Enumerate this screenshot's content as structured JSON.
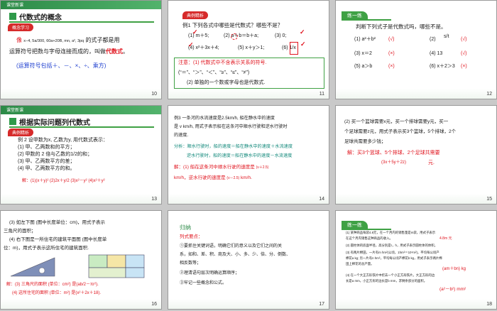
{
  "slides": [
    {
      "num": "10",
      "header": "课堂新课",
      "title": "代数式的概念",
      "tag": "概念学习",
      "line1_a": "像",
      "line1_formula": "x−4, 5a/300, 60a+20B, mn, a², 3pq",
      "line1_b": "的式子都是用",
      "line2_a": "运算符号把数与字母连接而成的，叫做",
      "line2_b": "代数式",
      "line2_c": "。",
      "line3": "(运算符号包括＋、－、×、÷、乘方)"
    },
    {
      "num": "11",
      "tag": "典例精析",
      "q": "例1  下列各式中哪些是代数式？哪些不是？",
      "opt1": "(1) m＋5;",
      "opt2": "(2) a＋b＝b＋a;",
      "opt3": "(3) 0;",
      "opt4": "(4) x²＋3x＋4;",
      "opt5": "(5) x＋y＞1;",
      "opt6": "(6) 1/x",
      "note1": "注意：(1) 代数式中不含表示关系的符号.",
      "note2": "(“＝”、“＞”、“＜”、“≥”、“≤”、“≠”)",
      "note3": "(2) 单独的一个数或字母也是代数式."
    },
    {
      "num": "12",
      "tag": "练一练",
      "q": "判断下列式子是代数式吗，哪些不是。",
      "r1a": "(1) a²＋b²",
      "r1b": "(√)",
      "r1c": "(2)",
      "r1d": "s/t",
      "r1e": "(√)",
      "r2a": "(3) x＝2",
      "r2b": "(×)",
      "r2c": "(4) 13",
      "r2d": "(√)",
      "r3a": "(5) a＞b",
      "r3b": "(×)",
      "r3c": "(6) x＋2＞3",
      "r3d": "(×)"
    },
    {
      "num": "13",
      "header": "课堂新课",
      "title": "根据实际问题列代数式",
      "tag": "典例精析",
      "l1": "例 2 设甲数为x, 乙数为y, 用代数式表示：",
      "l2": "(1) 甲、乙两数和的平方；",
      "l3": "(2) 甲数的 2 倍与乙数的1/2的和；",
      "l4": "(3) 甲、乙两数平方的差；",
      "l5": "(4) 甲、乙两数平方的和。",
      "ans": "解：(1)(x＋y)²  (2)2x＋y/2  (3)x²－y²  (4)x²＋y²"
    },
    {
      "num": "14",
      "l1": "例3  一条河的水流速度是2.5km/h, 船在静水中的速度",
      "l2": "是 v km/h, 用式子表示船在这条河中顺水行驶和逆水行驶时",
      "l3": "的速度.",
      "a1": "分析：顺水行驶时，船的速度＝船在静水中的速度＋水流速度",
      "a2": "逆水行驶时，船的速度＝船在静水中的速度－水流速度",
      "s1": "解：(1) 船在这条河中顺水行驶的速度是",
      "s1v": "(v＋2.5)",
      "s2": "km/h，逆水行驶的速度是",
      "s2v": "(v－2.5)",
      "s3": "km/h."
    },
    {
      "num": "15",
      "l1": "(2) 买一个篮球需要x元，买一个排球需要y元，买一",
      "l2": "个足球需要z元，用式子表示买3个篮球，5个排球，2个",
      "l3": "足球共需要多少钱；",
      "a1": "解：买3个篮球、5个排球、2个足球共需要",
      "a2": "(3x＋5y＋2z)",
      "a3": "元."
    },
    {
      "num": "16",
      "l1": "(3) 如左下图 (图中长度单位：cm)，用式子表示",
      "l2": "三角尺的面积；",
      "l3": "(4) 右下图是一所住宅的建筑平面图 (图中长度单",
      "l4": "位：m)，用式子表示这所住宅的建筑面积.",
      "a1": "解：(3) 三角尺的面积 (单位：cm²) 是(ab/2－πr²).",
      "a2": "(4) 这所住宅的面积 (单位：m²) 是(x²＋2x＋18)."
    },
    {
      "num": "17",
      "title": "归纳",
      "sub": "列式要点：",
      "p1": "①要抓住关键词语，明确它们的意义以及它们之间的关",
      "p2": "系，如和、差、积、商及大、小、多、少、倍、分、倒数、",
      "p3": "相反数等；",
      "p4": "②理清语句层次明确运算顺序；",
      "p5": "③牢记一些概念和公式。"
    },
    {
      "num": "18",
      "tag": "练一练",
      "p1": "(1) 某种商品每袋4.8元，在一个月内的销售量是m袋，用式子表示",
      "p2": "在这个月内销售这种商品的收入。",
      "ans1": "4.8m 元",
      "p3": "(2) 圆柱体的底面半径，高分别是r，h，用式子表示圆柱体的体积。",
      "p4": "(3) 有两片棉田，一片有m hm²(公顷，1hm²＝10⁴m²)，平均每公顷产",
      "p5": "棉花a kg; 另一片有n hm²，平均每公顷产棉花b kg，用式子表示两片棉",
      "p6": "田上棉花的总产量。",
      "ans3": "(am＋bn) kg",
      "p7": "(4) 在一个大正方形铁片中挖去一个小正方形铁片，大正方形的边",
      "p8": "长是a mm，小正方形的边长是b mm，求剩余部分的面积。",
      "ans4": "(a²－b²) mm²"
    }
  ]
}
